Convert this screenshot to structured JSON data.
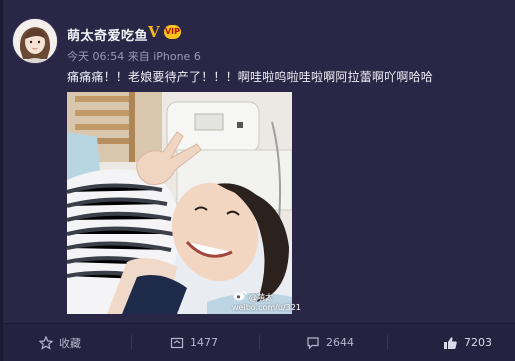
{
  "post": {
    "username": "萌太奇爱吃鱼",
    "verified_mark": "V",
    "vip_badge": "VIP",
    "meta": "今天 06:54 来自 iPhone 6",
    "text": "痛痛痛！！老娘要待产了！！！啊哇啦呜啦哇啦啊阿拉蕾啊吖啊哈哈",
    "image_watermark": {
      "handle": "@萌太",
      "url": "weibo.com/u/321"
    }
  },
  "actions": {
    "favorite": {
      "label": "收藏",
      "icon": "star-icon"
    },
    "repost": {
      "count": "1477",
      "icon": "repost-icon"
    },
    "comment": {
      "count": "2644",
      "icon": "comment-icon"
    },
    "like": {
      "count": "7203",
      "icon": "thumbs-up-icon"
    }
  },
  "colors": {
    "background": "#2a2746",
    "action_bar": "#252240",
    "verified": "#f3b71a",
    "text": "#f0eef7",
    "muted": "#9b98b3"
  }
}
